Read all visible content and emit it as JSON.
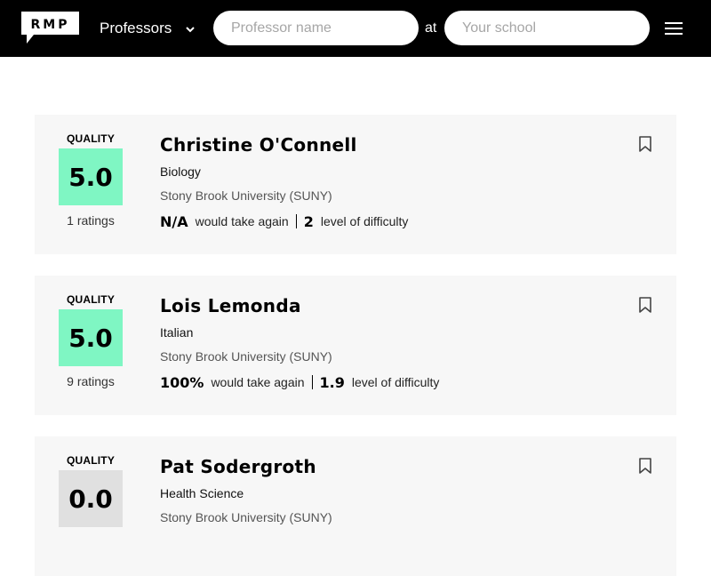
{
  "header": {
    "logo_text": "RMP",
    "search_type": "Professors",
    "professor_placeholder": "Professor name",
    "at_label": "at",
    "school_placeholder": "Your school"
  },
  "colors": {
    "header_bg": "#000000",
    "high_quality": "#7ff6c3",
    "low_quality": "#e0e0e0",
    "card_bg": "#f7f7f7"
  },
  "cards": [
    {
      "quality_label": "QUALITY",
      "quality": "5.0",
      "quality_color": "#7ff6c3",
      "ratings": "1 ratings",
      "name": "Christine O'Connell",
      "department": "Biology",
      "school": "Stony Brook University (SUNY)",
      "would_take_again": "N/A",
      "would_take_again_label": "would take again",
      "difficulty": "2",
      "difficulty_label": "level of difficulty"
    },
    {
      "quality_label": "QUALITY",
      "quality": "5.0",
      "quality_color": "#7ff6c3",
      "ratings": "9 ratings",
      "name": "Lois Lemonda",
      "department": "Italian",
      "school": "Stony Brook University (SUNY)",
      "would_take_again": "100%",
      "would_take_again_label": "would take again",
      "difficulty": "1.9",
      "difficulty_label": "level of difficulty"
    },
    {
      "quality_label": "QUALITY",
      "quality": "0.0",
      "quality_color": "#e0e0e0",
      "name": "Pat Sodergroth",
      "department": "Health Science",
      "school": "Stony Brook University (SUNY)"
    }
  ]
}
